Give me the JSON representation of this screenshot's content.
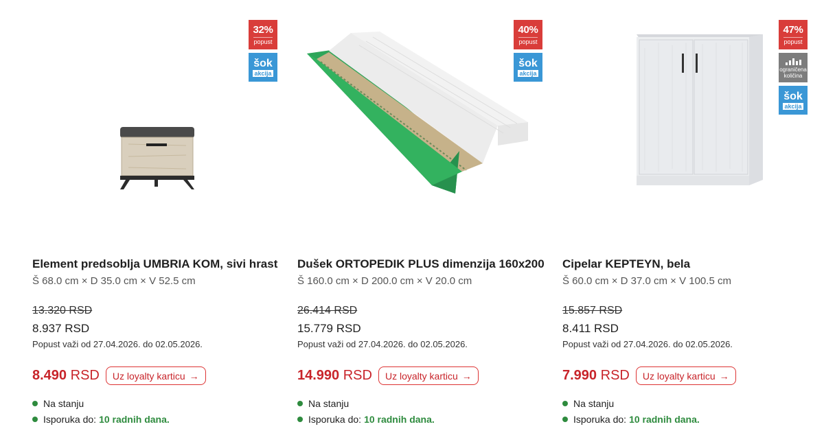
{
  "products": [
    {
      "title": "Element predsoblja UMBRIA KOM, sivi hrast",
      "dimensions": "Š 68.0 cm × D 35.0 cm × V 52.5 cm",
      "old_price": "13.320 RSD",
      "price": "8.937 RSD",
      "discount_note": "Popust važi od 27.04.2026. do 02.05.2026.",
      "loyalty_price": "8.490",
      "currency": "RSD",
      "loyalty_button": "Uz loyalty karticu",
      "stock": "Na stanju",
      "delivery_label": "Isporuka do:",
      "delivery_value": "10 radnih dana.",
      "badge_percent": "32%",
      "badge_word": "popust",
      "sok_top": "šok",
      "sok_bottom": "akcija",
      "image": "shoe-bench-icon"
    },
    {
      "title": "Dušek ORTOPEDIK PLUS dimenzija 160x200",
      "dimensions": "Š 160.0 cm × D 200.0 cm × V 20.0 cm",
      "old_price": "26.414 RSD",
      "price": "15.779 RSD",
      "discount_note": "Popust važi od 27.04.2026. do 02.05.2026.",
      "loyalty_price": "14.990",
      "currency": "RSD",
      "loyalty_button": "Uz loyalty karticu",
      "stock": "Na stanju",
      "delivery_label": "Isporuka do:",
      "delivery_value": "10 radnih dana.",
      "badge_percent": "40%",
      "badge_word": "popust",
      "sok_top": "šok",
      "sok_bottom": "akcija",
      "image": "mattress-icon"
    },
    {
      "title": "Cipelar KEPTEYN, bela",
      "dimensions": "Š 60.0 cm × D 37.0 cm × V 100.5 cm",
      "old_price": "15.857 RSD",
      "price": "8.411 RSD",
      "discount_note": "Popust važi od 27.04.2026. do 02.05.2026.",
      "loyalty_price": "7.990",
      "currency": "RSD",
      "loyalty_button": "Uz loyalty karticu",
      "stock": "Na stanju",
      "delivery_label": "Isporuka do:",
      "delivery_value": "10 radnih dana.",
      "badge_percent": "47%",
      "badge_word": "popust",
      "limited_line1": "ograničena",
      "limited_line2": "količina",
      "sok_top": "šok",
      "sok_bottom": "akcija",
      "image": "shoe-cabinet-icon"
    }
  ],
  "colors": {
    "accent_red": "#c8242a",
    "badge_red": "#d93d3a",
    "badge_blue": "#3a97d6",
    "badge_gray": "#7d7d7d",
    "stock_green": "#2e8b3e"
  }
}
